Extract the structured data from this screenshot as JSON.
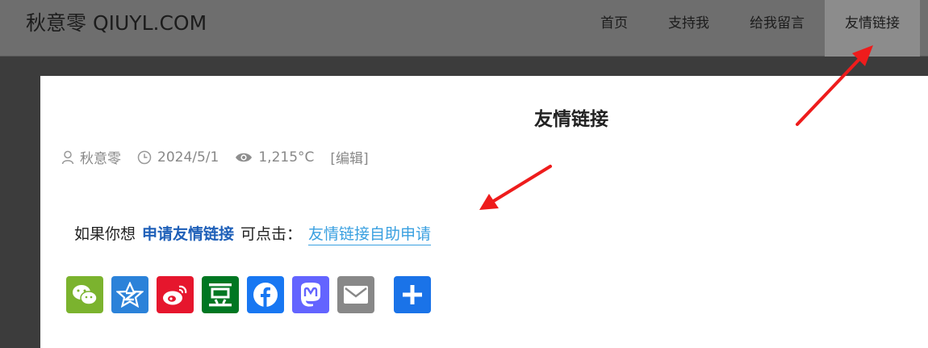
{
  "header": {
    "site_title": "秋意零 QIUYL.COM",
    "nav": [
      {
        "label": "首页"
      },
      {
        "label": "支持我"
      },
      {
        "label": "给我留言"
      },
      {
        "label": "友情链接",
        "active": true
      }
    ]
  },
  "post": {
    "title": "友情链接",
    "meta": {
      "author": "秋意零",
      "date": "2024/5/1",
      "views": "1,215°C",
      "edit": "[编辑]"
    },
    "body": {
      "prefix": "如果你想",
      "emphasis": "申请友情链接",
      "middle": "可点击：",
      "link": "友情链接自助申请"
    }
  },
  "share": [
    {
      "icon": "wechat-icon",
      "color": "#7bb32e"
    },
    {
      "icon": "qzone-icon",
      "color": "#2b82d9"
    },
    {
      "icon": "weibo-icon",
      "color": "#e6162d"
    },
    {
      "icon": "douban-icon",
      "color": "#007722"
    },
    {
      "icon": "facebook-icon",
      "color": "#1877f2"
    },
    {
      "icon": "mastodon-icon",
      "color": "#6364ff"
    },
    {
      "icon": "email-icon",
      "color": "#888888"
    },
    {
      "icon": "share-plus-icon",
      "color": "#1a73e8"
    }
  ],
  "colors": {
    "header_bg": "#6e6e6e",
    "active_tab_bg": "#8c8c8c",
    "accent_blue": "#1e5fb8",
    "link_blue": "#3aa0e0",
    "arrow_red": "#ee1c1c"
  }
}
